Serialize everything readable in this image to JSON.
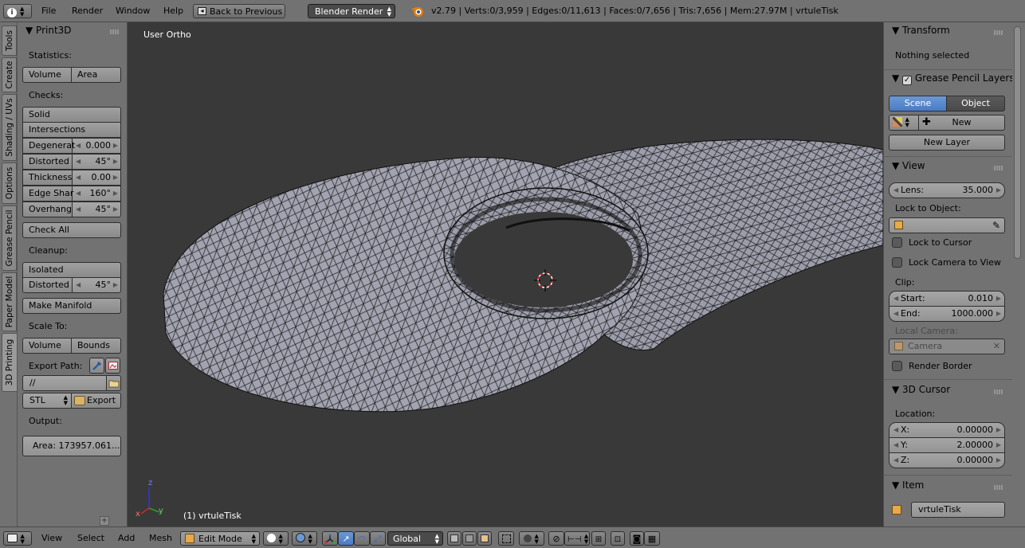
{
  "topbar": {
    "menus": [
      "File",
      "Render",
      "Window",
      "Help"
    ],
    "back_button": "Back to Previous",
    "render_engine": "Blender Render",
    "stats": "v2.79 | Verts:0/3,959 | Edges:0/11,613 | Faces:0/7,656 | Tris:7,656 | Mem:27.97M | vrtuleTisk"
  },
  "tool_tabs": [
    "Tools",
    "Create",
    "Shading / UVs",
    "Options",
    "Grease Pencil",
    "Paper Model",
    "3D Printing"
  ],
  "print3d": {
    "title": "Print3D",
    "statistics_label": "Statistics:",
    "volume_btn": "Volume",
    "area_btn": "Area",
    "checks_label": "Checks:",
    "solid_btn": "Solid",
    "intersections_btn": "Intersections",
    "checks": [
      {
        "label": "Degenerat",
        "value": "0.000"
      },
      {
        "label": "Distorted",
        "value": "45°"
      },
      {
        "label": "Thickness",
        "value": "0.00"
      },
      {
        "label": "Edge Shar",
        "value": "160°"
      },
      {
        "label": "Overhang",
        "value": "45°"
      }
    ],
    "check_all_btn": "Check All",
    "cleanup_label": "Cleanup:",
    "isolated_btn": "Isolated",
    "distorted_label": "Distorted",
    "distorted_value": "45°",
    "make_manifold_btn": "Make Manifold",
    "scale_to_label": "Scale To:",
    "scale_volume_btn": "Volume",
    "scale_bounds_btn": "Bounds",
    "export_path_label": "Export Path:",
    "export_path_value": "//",
    "format_value": "STL",
    "export_btn": "Export",
    "output_label": "Output:",
    "output_value": "Area: 173957.061..."
  },
  "viewport": {
    "view_name": "User Ortho",
    "object_label": "(1) vrtuleTisk",
    "axis_z": "z",
    "axis_y": "y",
    "axis_x": "x"
  },
  "properties": {
    "transform_title": "Transform",
    "nothing_selected": "Nothing selected",
    "grease_title": "Grease Pencil Layers",
    "scene_btn": "Scene",
    "object_btn": "Object",
    "new_btn": "New",
    "new_layer_btn": "New Layer",
    "view_title": "View",
    "lens_label": "Lens:",
    "lens_value": "35.000",
    "lock_object_label": "Lock to Object:",
    "lock_cursor_label": "Lock to Cursor",
    "lock_camera_label": "Lock Camera to View",
    "clip_label": "Clip:",
    "clip_start_label": "Start:",
    "clip_start_value": "0.010",
    "clip_end_label": "End:",
    "clip_end_value": "1000.000",
    "local_camera_label": "Local Camera:",
    "camera_value": "Camera",
    "render_border_label": "Render Border",
    "cursor_title": "3D Cursor",
    "location_label": "Location:",
    "x_label": "X:",
    "x_value": "0.00000",
    "y_label": "Y:",
    "y_value": "2.00000",
    "z_label": "Z:",
    "z_value": "0.00000",
    "item_title": "Item",
    "item_name": "vrtuleTisk"
  },
  "bottombar": {
    "menus": [
      "View",
      "Select",
      "Add",
      "Mesh"
    ],
    "mode": "Edit Mode",
    "orientation": "Global"
  },
  "colors": {
    "panel_bg": "#727272",
    "viewport_bg": "#393939",
    "mesh_fill": "#9d9dab",
    "accent_blue": "#5680c2"
  }
}
